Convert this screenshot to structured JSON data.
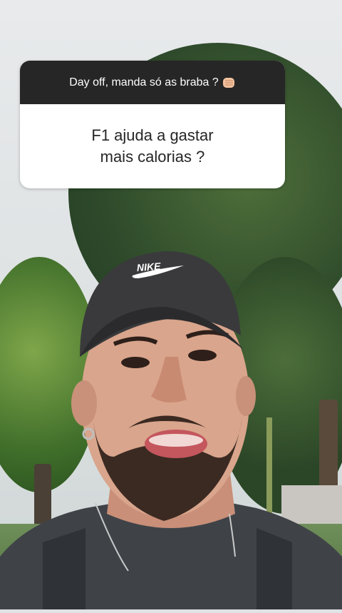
{
  "question_sticker": {
    "prompt": "Day off, manda só as braba ?",
    "answer": "F1 ajuda a gastar\nmais calorias ?"
  },
  "icons": {
    "prompt_icon": "fist-emoji-icon"
  },
  "scene": {
    "description": "man-wearing-nike-cap-selfie"
  },
  "colors": {
    "sticker_header": "#262626",
    "sticker_body": "#ffffff",
    "text_dark": "#262626",
    "cap": "#3a3a3c",
    "shirt": "#3f4348"
  }
}
